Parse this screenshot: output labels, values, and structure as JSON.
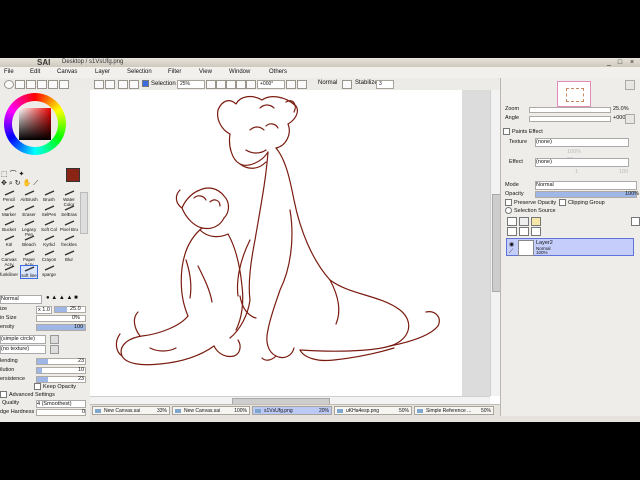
{
  "window": {
    "logo": "SAI",
    "title": "Desktop / s1VsUfg.png",
    "minimize": "_",
    "maximize": "□",
    "close": "×"
  },
  "menu": [
    "File",
    "Edit",
    "Canvas",
    "Layer",
    "Selection",
    "Filter",
    "View",
    "Window",
    "Others"
  ],
  "toolbar": {
    "selection_label": "Selection",
    "zoom": "25%",
    "rotation": "+000°",
    "blend_label": "Normal",
    "stabilizer_label": "Stabilizer",
    "stabilizer_value": "3"
  },
  "colors": {
    "primary": "#8a2414",
    "secondary": "#ffffff",
    "line_art": "#7a1c10",
    "accent": "#3b6de0"
  },
  "tools": [
    "Pencil",
    "AirBrush",
    "Brush",
    "Water Color",
    "Marker",
    "Eraser",
    "SelPen",
    "SelEras",
    "Bucket",
    "Legacy Pen",
    "Soft Col",
    "Pixel Bru",
    "Kūl",
    "Bleach",
    "Kyrkd",
    "freckles",
    "Canvas Acry",
    "Paper Acry",
    "Crayon",
    "Blur",
    "funkiliner",
    "soft line",
    "sparge"
  ],
  "selected_tool": "soft line",
  "brush": {
    "blend_mode": "Normal",
    "size_label": "ize",
    "size_mult": "x 1.0",
    "size_value": "25.0",
    "min_size_label": "in Size",
    "min_size_value": "0%",
    "density_label": "ensity",
    "density_value": "100",
    "shape": "(simple circle)",
    "texture": "(no texture)",
    "blending_label": "lending",
    "blending_value": "23",
    "dilution_label": "ilution",
    "dilution_value": "10",
    "persistence_label": "ersistence",
    "persistence_value": "23",
    "keep_opacity": "Keep Opacity",
    "advanced": "Advanced Settings",
    "quality_label": "Quality",
    "quality_value": "4 (Smoothest)",
    "edge_label": "dge Hardness",
    "edge_value": "0"
  },
  "navigator": {
    "zoom_label": "Zoom",
    "zoom_value": "25.0%",
    "angle_label": "Angle",
    "angle_value": "+0000"
  },
  "layer_props": {
    "paint_effect": "Paints Effect",
    "texture_label": "Texture",
    "texture_value": "(none)",
    "texture_scale": "100%",
    "texture_amount": "20",
    "effect_label": "Effect",
    "effect_value": "(none)",
    "effect_width": "1",
    "effect_amount": "100",
    "mode_label": "Mode",
    "mode_value": "Normal",
    "opacity_label": "Opacity",
    "opacity_value": "100%",
    "preserve_opacity": "Preserve Opacity",
    "clipping_group": "Clipping Group",
    "selection_source": "Selection Source"
  },
  "layers": [
    {
      "name": "Layer2",
      "mode": "Normal",
      "opacity": "100%"
    }
  ],
  "tabs": [
    {
      "name": "New Canvas.sai",
      "zoom": "33%"
    },
    {
      "name": "New Canvas.sai",
      "zoom": "100%"
    },
    {
      "name": "s1VsUfg.png",
      "zoom": "20%"
    },
    {
      "name": "uKHa4esp.png",
      "zoom": "50%"
    },
    {
      "name": "Simple Reference ...",
      "zoom": "50%"
    }
  ],
  "active_tab": 2
}
